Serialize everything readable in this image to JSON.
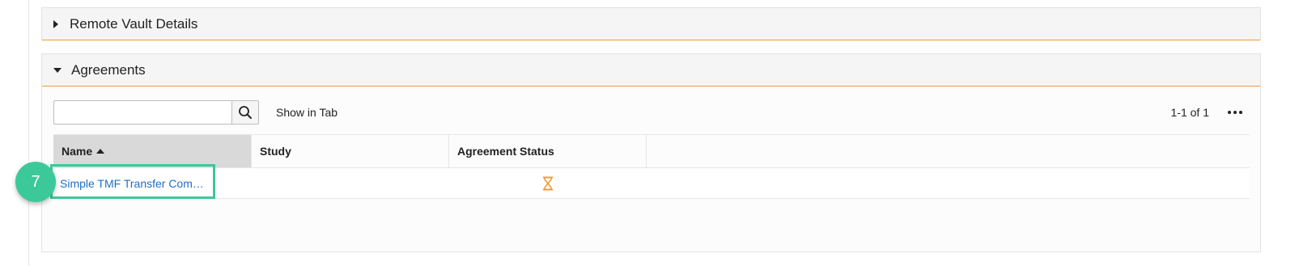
{
  "sections": {
    "remote_vault": {
      "title": "Remote Vault Details"
    },
    "agreements": {
      "title": "Agreements"
    }
  },
  "toolbar": {
    "search_value": "",
    "search_placeholder": "",
    "show_in_tab": "Show in Tab",
    "pager": "1-1 of 1"
  },
  "grid": {
    "columns": [
      "Name",
      "Study",
      "Agreement Status"
    ],
    "rows": [
      {
        "name": "Simple TMF Transfer Com…",
        "study": "",
        "status_icon": "hourglass-icon"
      }
    ]
  },
  "annotation": {
    "step": "7"
  },
  "colors": {
    "accent_orange": "#f29a3a",
    "link_blue": "#1e6fc7",
    "highlight_green": "#3cc99a",
    "status_pending": "#f29a3a"
  }
}
